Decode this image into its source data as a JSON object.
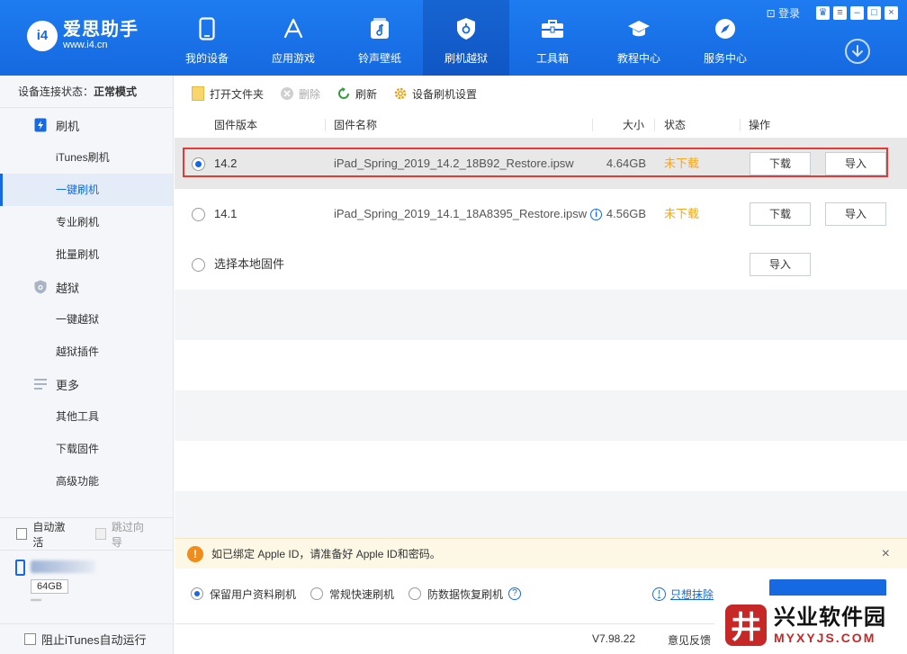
{
  "app": {
    "logo_name": "爱思助手",
    "logo_url": "www.i4.cn",
    "logo_badge": "i4",
    "login": "登录"
  },
  "nav": [
    {
      "label": "我的设备",
      "icon": "phone-icon"
    },
    {
      "label": "应用游戏",
      "icon": "app-store-icon"
    },
    {
      "label": "铃声壁纸",
      "icon": "music-icon"
    },
    {
      "label": "刷机越狱",
      "icon": "shield-icon",
      "active": true
    },
    {
      "label": "工具箱",
      "icon": "toolbox-icon"
    },
    {
      "label": "教程中心",
      "icon": "graduation-cap-icon"
    },
    {
      "label": "服务中心",
      "icon": "compass-icon"
    }
  ],
  "sidebar": {
    "status_label": "设备连接状态：",
    "status_value": "正常模式",
    "groups": [
      {
        "label": "刷机",
        "icon": "flash-icon",
        "items": [
          "iTunes刷机",
          "一键刷机",
          "专业刷机",
          "批量刷机"
        ]
      },
      {
        "label": "越狱",
        "icon": "shield-icon",
        "items": [
          "一键越狱",
          "越狱插件"
        ]
      },
      {
        "label": "更多",
        "icon": "menu-icon",
        "items": [
          "其他工具",
          "下载固件",
          "高级功能"
        ]
      }
    ],
    "active_item": "一键刷机",
    "auto_activate": "自动激活",
    "skip_guide": "跳过向导",
    "device_capacity": "64GB",
    "block_itunes": "阻止iTunes自动运行"
  },
  "toolbar": {
    "open_folder": "打开文件夹",
    "delete": "删除",
    "refresh": "刷新",
    "device_settings": "设备刷机设置"
  },
  "table": {
    "headers": {
      "version": "固件版本",
      "name": "固件名称",
      "size": "大小",
      "status": "状态",
      "action": "操作"
    },
    "rows": [
      {
        "version": "14.2",
        "name": "iPad_Spring_2019_14.2_18B92_Restore.ipsw",
        "size": "4.64GB",
        "status": "未下载",
        "download": "下载",
        "import": "导入",
        "selected": true,
        "info": false
      },
      {
        "version": "14.1",
        "name": "iPad_Spring_2019_14.1_18A8395_Restore.ipsw",
        "size": "4.56GB",
        "status": "未下载",
        "download": "下载",
        "import": "导入",
        "selected": false,
        "info": true
      },
      {
        "version": "选择本地固件",
        "import": "导入"
      }
    ],
    "info_glyph": "i"
  },
  "notice": {
    "text": "如已绑定 Apple ID，请准备好 Apple ID和密码。",
    "icon_glyph": "!",
    "close_glyph": "×"
  },
  "options": {
    "keep_data": "保留用户资料刷机",
    "quick": "常规快速刷机",
    "anti_recovery": "防数据恢复刷机",
    "help_glyph": "?",
    "erase_link": "只想抹除",
    "erase_icon_glyph": "!"
  },
  "status_bar": {
    "version": "V7.98.22",
    "feedback": "意见反馈"
  },
  "watermark": {
    "title": "兴业软件园",
    "url": "MYXYJS.COM",
    "logo_glyph": "井"
  },
  "colors": {
    "brand_blue": "#1669e0",
    "status_orange": "#f5a623",
    "highlight_red": "#e53935"
  }
}
